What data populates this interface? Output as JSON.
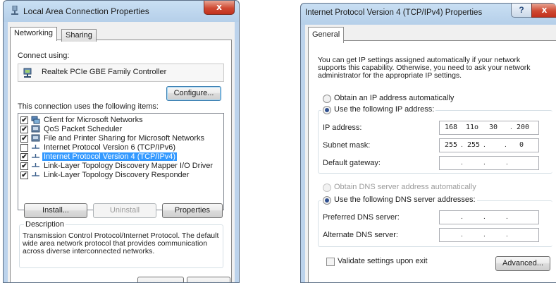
{
  "left_dialog": {
    "title": "Local Area Connection Properties",
    "close": "x",
    "tabs": [
      "Networking",
      "Sharing"
    ],
    "connect_using_label": "Connect using:",
    "adapter_name": "Realtek PCIe GBE Family Controller",
    "configure_button": "Configure...",
    "items_label": "This connection uses the following items:",
    "items": [
      {
        "label": "Client for Microsoft Networks",
        "checked": "✔",
        "icon": "network-client-icon"
      },
      {
        "label": "QoS Packet Scheduler",
        "checked": "✔",
        "icon": "qos-icon"
      },
      {
        "label": "File and Printer Sharing for Microsoft Networks",
        "checked": "✔",
        "icon": "file-sharing-icon"
      },
      {
        "label": "Internet Protocol Version 6 (TCP/IPv6)",
        "checked": "",
        "icon": "protocol-icon"
      },
      {
        "label": "Internet Protocol Version 4 (TCP/IPv4)",
        "checked": "✔",
        "icon": "protocol-icon",
        "selected": true
      },
      {
        "label": "Link-Layer Topology Discovery Mapper I/O Driver",
        "checked": "✔",
        "icon": "protocol-icon"
      },
      {
        "label": "Link-Layer Topology Discovery Responder",
        "checked": "✔",
        "icon": "protocol-icon"
      }
    ],
    "install_button": "Install...",
    "uninstall_button": "Uninstall",
    "properties_button": "Properties",
    "description_title": "Description",
    "description_text": "Transmission Control Protocol/Internet Protocol. The default wide area network protocol that provides communication across diverse interconnected networks."
  },
  "right_dialog": {
    "title": "Internet Protocol Version 4 (TCP/IPv4) Properties",
    "help": "?",
    "close": "x",
    "tab": "General",
    "intro": "You can get IP settings assigned automatically if your network supports this capability. Otherwise, you need to ask your network administrator for the appropriate IP settings.",
    "obtain_ip_auto": "Obtain an IP address automatically",
    "use_following_ip": "Use the following IP address:",
    "ip_address_label": "IP address:",
    "ip_address": [
      "168",
      "11o",
      "30",
      "200"
    ],
    "subnet_label": "Subnet mask:",
    "subnet": [
      "255",
      "255",
      "",
      "0"
    ],
    "gateway_label": "Default gateway:",
    "obtain_dns_auto": "Obtain DNS server address automatically",
    "use_following_dns": "Use the following DNS server addresses:",
    "preferred_dns_label": "Preferred DNS server:",
    "alternate_dns_label": "Alternate DNS server:",
    "validate_label": "Validate settings upon exit",
    "advanced_button": "Advanced..."
  },
  "colors": {
    "selection": "#3399ff",
    "title_gradient": "#c9dff3",
    "close_red": "#cf4a33"
  }
}
